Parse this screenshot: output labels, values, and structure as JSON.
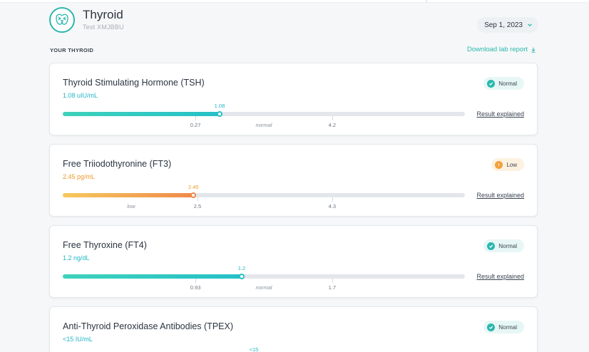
{
  "header": {
    "title": "Thyroid",
    "subtitle": "Test XMJBBU",
    "date": "Sep 1, 2023"
  },
  "section": {
    "label": "YOUR THYROID",
    "download": "Download lab report"
  },
  "colors": {
    "accent": "#2bb7ae",
    "normal": "#22b6c6",
    "low": "#ee9a2a"
  },
  "tests": [
    {
      "name": "Thyroid Stimulating Hormone (TSH)",
      "value": "1.08 uIU/mL",
      "status": "Normal",
      "status_icon": "check-icon",
      "marker": "1.08",
      "marker_fraction": 0.39,
      "ticks": [
        "0.27",
        "4.2"
      ],
      "zone": "normal",
      "explain": "Result explained"
    },
    {
      "name": "Free Triiodothyronine (FT3)",
      "value": "2.45 pg/mL",
      "status": "Low",
      "status_icon": "alert-icon",
      "marker": "2.45",
      "marker_fraction": 0.325,
      "ticks": [
        "2.5",
        "4.3"
      ],
      "zone": "low",
      "explain": "Result explained"
    },
    {
      "name": "Free Thyroxine (FT4)",
      "value": "1.2 ng/dL",
      "status": "Normal",
      "status_icon": "check-icon",
      "marker": "1.2",
      "marker_fraction": 0.445,
      "ticks": [
        "0.93",
        "1.7"
      ],
      "zone": "normal",
      "explain": "Result explained"
    },
    {
      "name": "Anti-Thyroid Peroxidase Antibodies (TPEX)",
      "value": "<15 IU/mL",
      "status": "Normal",
      "status_icon": "check-icon",
      "marker": "<15"
    }
  ]
}
